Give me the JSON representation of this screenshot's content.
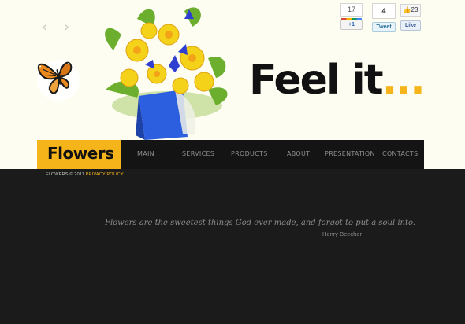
{
  "slider": {
    "prev_icon": "chevron-left-icon",
    "next_icon": "chevron-right-icon"
  },
  "tagline": {
    "main": "Feel it",
    "dots": "..."
  },
  "social": {
    "gplus": {
      "count": "17",
      "label": "+1"
    },
    "twitter": {
      "count": "4",
      "label": "Tweet"
    },
    "facebook": {
      "count": "23",
      "label": "Like"
    }
  },
  "logo": {
    "text": "Flowers"
  },
  "nav": {
    "items": [
      "MAIN",
      "SERVICES",
      "PRODUCTS",
      "ABOUT",
      "PRESENTATION",
      "CONTACTS"
    ]
  },
  "footer": {
    "copyright": "FLOWERS © 2011",
    "privacy": "PRIVACY POLICY"
  },
  "quote": {
    "text": "Flowers are the sweetest things God ever made, and forgot to put a soul into.",
    "author": "Henry Beecher"
  },
  "colors": {
    "accent": "#f4b41a",
    "background": "#1b1b1b",
    "hero": "#fdfdf1",
    "nav": "#141414"
  }
}
